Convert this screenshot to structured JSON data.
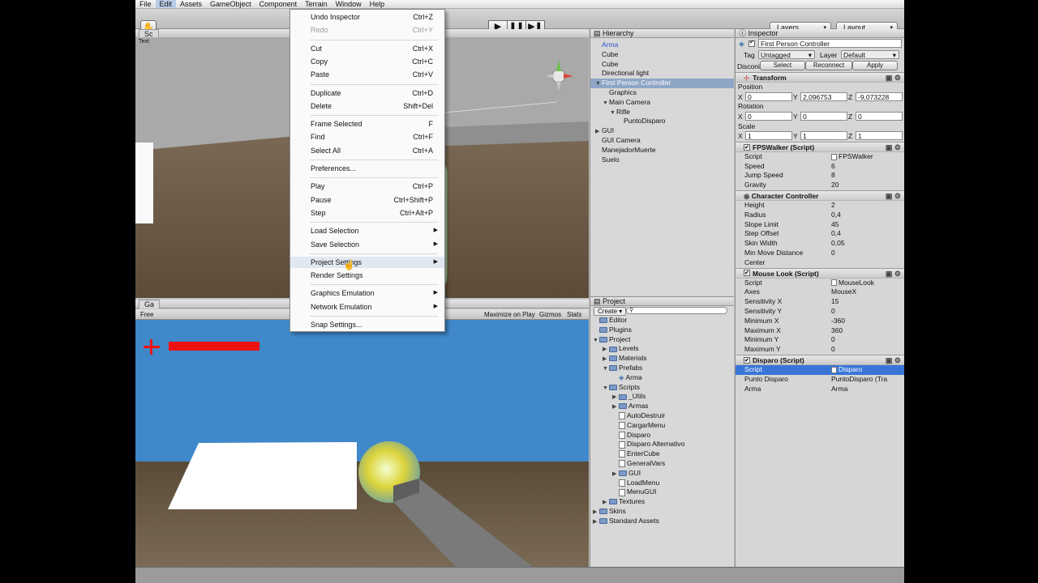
{
  "menubar": [
    "File",
    "Edit",
    "Assets",
    "GameObject",
    "Component",
    "Terrain",
    "Window",
    "Help"
  ],
  "toolbar": {
    "layers_label": "Layers",
    "layout_label": "Layout",
    "play_icon": "▶",
    "pause_icon": "❚❚",
    "step_icon": "▶❚"
  },
  "edit_menu": [
    {
      "label": "Undo Inspector",
      "shortcut": "Ctrl+Z"
    },
    {
      "label": "Redo",
      "shortcut": "Ctrl+Y",
      "disabled": true
    },
    {
      "label": "Cut",
      "shortcut": "Ctrl+X"
    },
    {
      "label": "Copy",
      "shortcut": "Ctrl+C"
    },
    {
      "label": "Paste",
      "shortcut": "Ctrl+V"
    },
    {
      "label": "Duplicate",
      "shortcut": "Ctrl+D"
    },
    {
      "label": "Delete",
      "shortcut": "Shift+Del"
    },
    {
      "label": "Frame Selected",
      "shortcut": "F"
    },
    {
      "label": "Find",
      "shortcut": "Ctrl+F"
    },
    {
      "label": "Select All",
      "shortcut": "Ctrl+A"
    },
    {
      "label": "Preferences...",
      "shortcut": ""
    },
    {
      "label": "Play",
      "shortcut": "Ctrl+P"
    },
    {
      "label": "Pause",
      "shortcut": "Ctrl+Shift+P"
    },
    {
      "label": "Step",
      "shortcut": "Ctrl+Alt+P"
    },
    {
      "label": "Load Selection",
      "shortcut": "",
      "submenu": true
    },
    {
      "label": "Save Selection",
      "shortcut": "",
      "submenu": true
    },
    {
      "label": "Project Settings",
      "shortcut": "",
      "submenu": true,
      "hover": true
    },
    {
      "label": "Render Settings",
      "shortcut": ""
    },
    {
      "label": "Graphics Emulation",
      "shortcut": "",
      "submenu": true
    },
    {
      "label": "Network Emulation",
      "shortcut": "",
      "submenu": true
    },
    {
      "label": "Snap Settings...",
      "shortcut": ""
    }
  ],
  "scene": {
    "tab_label": "Sc",
    "sub_label": "Text"
  },
  "game": {
    "tab_label": "Ga",
    "free_label": "Free",
    "maximize_label": "Maximize on Play",
    "gizmos_label": "Gizmos",
    "stats_label": "Stats"
  },
  "hierarchy": {
    "title": "Hierarchy",
    "items": [
      {
        "label": "Arma",
        "indent": 0,
        "blue": true
      },
      {
        "label": "Cube",
        "indent": 0
      },
      {
        "label": "Cube",
        "indent": 0
      },
      {
        "label": "Directional light",
        "indent": 0
      },
      {
        "label": "First Person Controller",
        "indent": 0,
        "selected": true,
        "expanded": true
      },
      {
        "label": "Graphics",
        "indent": 1
      },
      {
        "label": "Main Camera",
        "indent": 1,
        "expanded": true
      },
      {
        "label": "Rifle",
        "indent": 2,
        "expanded": true
      },
      {
        "label": "PuntoDisparo",
        "indent": 3
      },
      {
        "label": "GUI",
        "indent": 0,
        "collapsed": true
      },
      {
        "label": "GUI Camera",
        "indent": 0
      },
      {
        "label": "ManejadorMuerte",
        "indent": 0
      },
      {
        "label": "Suelo",
        "indent": 0
      }
    ]
  },
  "project": {
    "title": "Project",
    "create_label": "Create",
    "items": [
      {
        "label": "Editor",
        "indent": 0,
        "type": "folder"
      },
      {
        "label": "Plugins",
        "indent": 0,
        "type": "folder"
      },
      {
        "label": "Project",
        "indent": 0,
        "type": "folder",
        "expanded": true
      },
      {
        "label": "Levels",
        "indent": 1,
        "type": "folder",
        "collapsed": true
      },
      {
        "label": "Materials",
        "indent": 1,
        "type": "folder",
        "collapsed": true
      },
      {
        "label": "Prefabs",
        "indent": 1,
        "type": "folder",
        "expanded": true
      },
      {
        "label": "Arma",
        "indent": 2,
        "type": "prefab"
      },
      {
        "label": "Scripts",
        "indent": 1,
        "type": "folder",
        "expanded": true
      },
      {
        "label": "_Utils",
        "indent": 2,
        "type": "folder",
        "collapsed": true
      },
      {
        "label": "Armas",
        "indent": 2,
        "type": "folder",
        "collapsed": true
      },
      {
        "label": "AutoDestruir",
        "indent": 2,
        "type": "file"
      },
      {
        "label": "CargarMenu",
        "indent": 2,
        "type": "file"
      },
      {
        "label": "Disparo",
        "indent": 2,
        "type": "file"
      },
      {
        "label": "Disparo Alternativo",
        "indent": 2,
        "type": "file"
      },
      {
        "label": "EnterCube",
        "indent": 2,
        "type": "file"
      },
      {
        "label": "GeneralVars",
        "indent": 2,
        "type": "file"
      },
      {
        "label": "GUI",
        "indent": 2,
        "type": "folder",
        "collapsed": true
      },
      {
        "label": "LoadMenu",
        "indent": 2,
        "type": "file"
      },
      {
        "label": "MenuGUI",
        "indent": 2,
        "type": "file"
      },
      {
        "label": "Textures",
        "indent": 1,
        "type": "folder",
        "collapsed": true
      },
      {
        "label": "Skins",
        "indent": 0,
        "type": "folder",
        "collapsed": true
      },
      {
        "label": "Standard Assets",
        "indent": 0,
        "type": "folder",
        "collapsed": true
      }
    ]
  },
  "inspector": {
    "title": "Inspector",
    "object_name": "First Person Controller",
    "tag_label": "Tag",
    "tag_value": "Untagged",
    "layer_label": "Layer",
    "layer_value": "Default",
    "disconnect_label": "Disconi",
    "select_label": "Select",
    "reconnect_label": "Reconnect",
    "apply_label": "Apply",
    "transform": {
      "title": "Transform",
      "position_label": "Position",
      "rotation_label": "Rotation",
      "scale_label": "Scale",
      "position": [
        "0",
        "2,096753",
        "-9,073228"
      ],
      "rotation": [
        "0",
        "0",
        "0"
      ],
      "scale": [
        "1",
        "1",
        "1"
      ]
    },
    "fpswalker": {
      "title": "FPSWalker (Script)",
      "rows": [
        {
          "label": "Script",
          "value": "FPSWalker",
          "icon": true
        },
        {
          "label": "Speed",
          "value": "6"
        },
        {
          "label": "Jump Speed",
          "value": "8"
        },
        {
          "label": "Gravity",
          "value": "20"
        }
      ]
    },
    "character_controller": {
      "title": "Character Controller",
      "rows": [
        {
          "label": "Height",
          "value": "2"
        },
        {
          "label": "Radius",
          "value": "0,4"
        },
        {
          "label": "Slope Limit",
          "value": "45"
        },
        {
          "label": "Step Offset",
          "value": "0,4"
        },
        {
          "label": "Skin Width",
          "value": "0,05"
        },
        {
          "label": "Min Move Distance",
          "value": "0"
        },
        {
          "label": "Center",
          "value": ""
        }
      ]
    },
    "mouse_look": {
      "title": "Mouse Look (Script)",
      "rows": [
        {
          "label": "Script",
          "value": "MouseLook",
          "icon": true
        },
        {
          "label": "Axes",
          "value": "MouseX"
        },
        {
          "label": "Sensitivity X",
          "value": "15"
        },
        {
          "label": "Sensitivity Y",
          "value": "0"
        },
        {
          "label": "Minimum X",
          "value": "-360"
        },
        {
          "label": "Maximum X",
          "value": "360"
        },
        {
          "label": "Minimum Y",
          "value": "0"
        },
        {
          "label": "Maximum Y",
          "value": "0"
        }
      ]
    },
    "disparo": {
      "title": "Disparo (Script)",
      "rows": [
        {
          "label": "Script",
          "value": "Disparo",
          "icon": true,
          "selected": true
        },
        {
          "label": "Punto Disparo",
          "value": "PuntoDisparo (Tra"
        },
        {
          "label": "Arma",
          "value": "Arma"
        }
      ]
    }
  },
  "colors": {
    "selection": "#3875d7",
    "hud_red": "#ee1111",
    "sky": "#3d85c6"
  }
}
